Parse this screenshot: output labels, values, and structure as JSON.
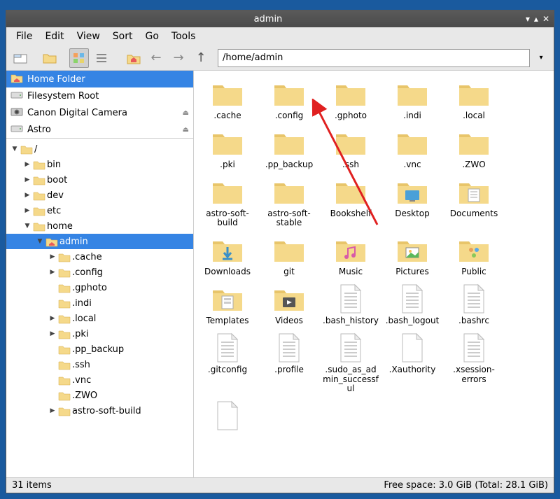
{
  "window": {
    "title": "admin"
  },
  "menu": [
    "File",
    "Edit",
    "View",
    "Sort",
    "Go",
    "Tools"
  ],
  "path": "/home/admin",
  "places": [
    {
      "label": "Home Folder",
      "icon": "home",
      "selected": true
    },
    {
      "label": "Filesystem Root",
      "icon": "drive"
    },
    {
      "label": "Canon Digital Camera",
      "icon": "camera",
      "eject": true
    },
    {
      "label": "Astro",
      "icon": "drive",
      "eject": true
    }
  ],
  "tree": [
    {
      "label": "/",
      "depth": 0,
      "expanded": true,
      "icon": "folder"
    },
    {
      "label": "bin",
      "depth": 1,
      "collapsed": true
    },
    {
      "label": "boot",
      "depth": 1,
      "collapsed": true
    },
    {
      "label": "dev",
      "depth": 1,
      "collapsed": true
    },
    {
      "label": "etc",
      "depth": 1,
      "collapsed": true
    },
    {
      "label": "home",
      "depth": 1,
      "expanded": true
    },
    {
      "label": "admin",
      "depth": 2,
      "expanded": true,
      "icon": "home",
      "selected": true
    },
    {
      "label": ".cache",
      "depth": 3,
      "collapsed": true
    },
    {
      "label": ".config",
      "depth": 3,
      "collapsed": true
    },
    {
      "label": ".gphoto",
      "depth": 3
    },
    {
      "label": ".indi",
      "depth": 3
    },
    {
      "label": ".local",
      "depth": 3,
      "collapsed": true
    },
    {
      "label": ".pki",
      "depth": 3,
      "collapsed": true
    },
    {
      "label": ".pp_backup",
      "depth": 3
    },
    {
      "label": ".ssh",
      "depth": 3
    },
    {
      "label": ".vnc",
      "depth": 3
    },
    {
      "label": ".ZWO",
      "depth": 3
    },
    {
      "label": "astro-soft-build",
      "depth": 3,
      "collapsed": true
    }
  ],
  "items": [
    {
      "label": ".cache",
      "type": "folder"
    },
    {
      "label": ".config",
      "type": "folder"
    },
    {
      "label": ".gphoto",
      "type": "folder"
    },
    {
      "label": ".indi",
      "type": "folder"
    },
    {
      "label": ".local",
      "type": "folder"
    },
    {
      "label": ".pki",
      "type": "folder"
    },
    {
      "label": ".pp_backup",
      "type": "folder"
    },
    {
      "label": ".ssh",
      "type": "folder"
    },
    {
      "label": ".vnc",
      "type": "folder"
    },
    {
      "label": ".ZWO",
      "type": "folder"
    },
    {
      "label": "astro-soft-build",
      "type": "folder"
    },
    {
      "label": "astro-soft-stable",
      "type": "folder"
    },
    {
      "label": "Bookshelf",
      "type": "folder"
    },
    {
      "label": "Desktop",
      "type": "desktop"
    },
    {
      "label": "Documents",
      "type": "documents"
    },
    {
      "label": "Downloads",
      "type": "downloads"
    },
    {
      "label": "git",
      "type": "folder"
    },
    {
      "label": "Music",
      "type": "music"
    },
    {
      "label": "Pictures",
      "type": "pictures"
    },
    {
      "label": "Public",
      "type": "public"
    },
    {
      "label": "Templates",
      "type": "templates"
    },
    {
      "label": "Videos",
      "type": "videos"
    },
    {
      "label": ".bash_history",
      "type": "file"
    },
    {
      "label": ".bash_logout",
      "type": "file"
    },
    {
      "label": ".bashrc",
      "type": "file"
    },
    {
      "label": ".gitconfig",
      "type": "file"
    },
    {
      "label": ".profile",
      "type": "file"
    },
    {
      "label": ".sudo_as_admin_successful",
      "type": "file"
    },
    {
      "label": ".Xauthority",
      "type": "blank"
    },
    {
      "label": ".xsession-errors",
      "type": "file"
    },
    {
      "label": "",
      "type": "blank"
    }
  ],
  "status": {
    "left": "31 items",
    "right": "Free space: 3.0 GiB (Total: 28.1 GiB)"
  },
  "colors": {
    "folder": "#f5d98a",
    "folder_tab": "#e8c56a",
    "selection": "#3584e4",
    "arrow": "#e02020"
  }
}
